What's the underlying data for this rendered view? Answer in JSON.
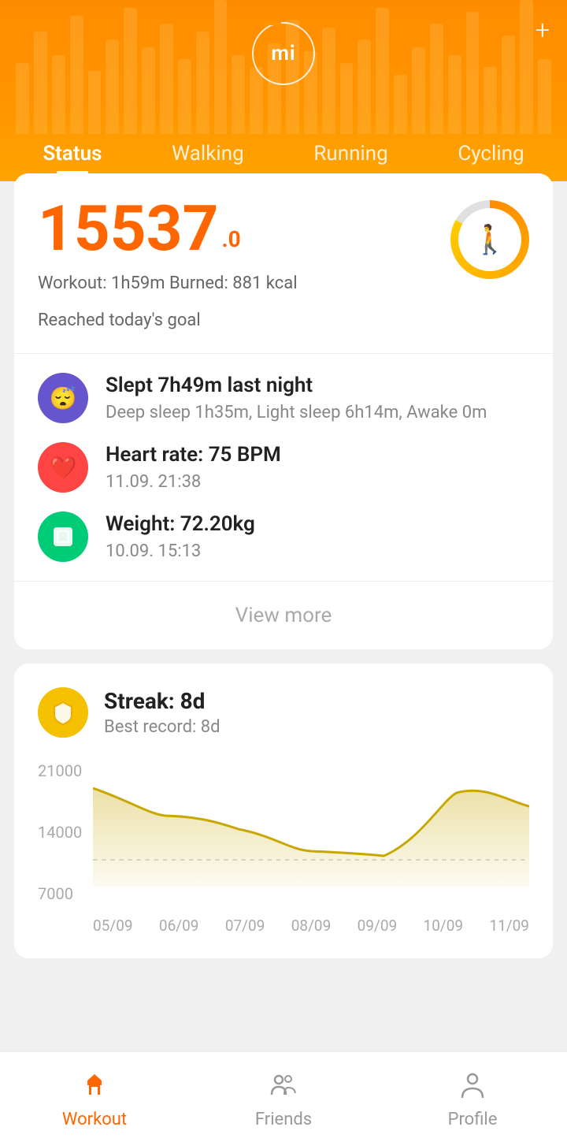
{
  "header": {
    "logo_text": "mi",
    "plus_icon": "+",
    "nav_tabs": [
      {
        "label": "Status",
        "active": true
      },
      {
        "label": "Walking",
        "active": false
      },
      {
        "label": "Running",
        "active": false
      },
      {
        "label": "Cycling",
        "active": false
      }
    ]
  },
  "stats": {
    "steps": "15537",
    "steps_unit": "0",
    "workout_info": "Workout: 1h59m Burned: 881 kcal",
    "goal_text": "Reached today's goal"
  },
  "health_items": [
    {
      "id": "sleep",
      "icon": "💤",
      "icon_class": "sleep-icon",
      "title": "Slept 7h49m last night",
      "subtitle": "Deep sleep 1h35m, Light sleep 6h14m, Awake 0m"
    },
    {
      "id": "heart",
      "icon": "❤️",
      "icon_class": "heart-icon",
      "title": "Heart rate: 75 BPM",
      "subtitle": "11.09. 21:38"
    },
    {
      "id": "weight",
      "icon": "🔲",
      "icon_class": "weight-icon",
      "title": "Weight: 72.20kg",
      "subtitle": "10.09. 15:13"
    }
  ],
  "view_more_label": "View more",
  "streak": {
    "icon": "🛡️",
    "title": "Streak: 8d",
    "subtitle": "Best record: 8d"
  },
  "chart": {
    "y_labels": [
      "21000",
      "14000",
      "7000"
    ],
    "x_labels": [
      "05/09",
      "06/09",
      "07/09",
      "08/09",
      "09/09",
      "10/09",
      "11/09"
    ],
    "goal_line": 10000,
    "data_points": [
      18000,
      15000,
      13500,
      11000,
      10500,
      17500,
      16000
    ]
  },
  "bottom_nav": [
    {
      "id": "workout",
      "label": "Workout",
      "active": true
    },
    {
      "id": "friends",
      "label": "Friends",
      "active": false
    },
    {
      "id": "profile",
      "label": "Profile",
      "active": false
    }
  ]
}
